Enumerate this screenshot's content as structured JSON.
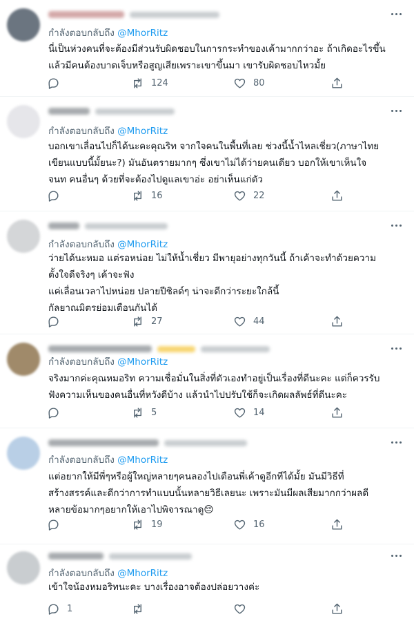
{
  "colors": {
    "link": "#1d9bf0",
    "text": "#0f1419",
    "muted": "#536471",
    "divider": "#eff3f4"
  },
  "icons": {
    "reply": "reply-icon",
    "retweet": "retweet-icon",
    "like": "like-icon",
    "share": "share-icon",
    "more": "more-options-icon"
  },
  "replies": [
    {
      "replying_label": "กำลังตอบกลับถึง",
      "mention": "@MhorRitz",
      "text": "นี่เป็นห่วงคนที่จะต้องมีส่วนรับผิดชอบในการกระทำของเค้ามากกว่าอะ ถ้าเกิดอะไรขึ้น\nแล้วมีคนต้องบาดเจ็บหรือสูญเสียเพราะเขาขึ้นมา เขารับผิดชอบไหวมั้ย",
      "reply_count": "",
      "retweet_count": "124",
      "like_count": "80"
    },
    {
      "replying_label": "กำลังตอบกลับถึง",
      "mention": "@MhorRitz",
      "text": "บอกเขาเลื่อนไปก็ได้นะคะคุณริท จากใจคนในพื้นที่เลย ช่วงนี้น้ำไหลเชี่ยว(ภาษาไทย\nเขียนแบบนี้มั้ยนะ?) มันอันตรายมากๆ ซึ่งเขาไม่ได้ว่ายคนเดียว บอกให้เขาเห็นใจ\nจนท คนอื่นๆ ด้วยที่จะต้องไปดูแลเขาอ่ะ อย่าเห็นแก่ตัว",
      "reply_count": "",
      "retweet_count": "16",
      "like_count": "22"
    },
    {
      "replying_label": "กำลังตอบกลับถึง",
      "mention": "@MhorRitz",
      "text": "ว่ายได้นะหมอ แต่รอหน่อย ไม่ให้น้ำเชี่ยว มีพายุอย่างทุกวันนี้ ถ้าเค้าจะทำด้วยความ\nตั้งใจดีจริงๆ เค้าจะฟัง\nแค่เลื่อนเวลาไปหน่อย ปลายปีชิลด์ๆ น่าจะดีกว่าระยะใกล้นี้\nกัลยาณมิตรย่อมเตือนกันได้",
      "reply_count": "",
      "retweet_count": "27",
      "like_count": "44"
    },
    {
      "replying_label": "กำลังตอบกลับถึง",
      "mention": "@MhorRitz",
      "text": "จริงมากค่ะคุณหมอริท ความเชื่อมั่นในสิ่งที่ตัวเองทำอยู่เป็นเรื่องที่ดีนะคะ แต่ก็ควรรับ\nฟังความเห็นของคนอื่นที่หวังดีบ้าง แล้วนำไปปรับใช้ก็จะเกิดผลลัพธ์ที่ดีนะคะ",
      "reply_count": "",
      "retweet_count": "5",
      "like_count": "14"
    },
    {
      "replying_label": "กำลังตอบกลับถึง",
      "mention": "@MhorRitz",
      "text": "แต่อยากให้มีพี่ๆหรือผู้ใหญ่หลายๆคนลองไปเตือนพี่เค้าดูอีกทีได้มั้ย มันมีวิธีที่\nสร้างสรรค์และดีกว่าการทำแบบนั้นหลายวิธีเลยนะ เพราะมันมีผลเสียมากกว่าผลดี\nหลายข้อมากๆอยากให้เอาไปพิจารณาดู😔",
      "reply_count": "",
      "retweet_count": "19",
      "like_count": "16"
    },
    {
      "replying_label": "กำลังตอบกลับถึง",
      "mention": "@MhorRitz",
      "text": "เข้าใจน้องหมอริทนะคะ บางเรื่องอาจต้องปล่อยวางค่ะ",
      "reply_count": "1",
      "retweet_count": "",
      "like_count": ""
    }
  ]
}
